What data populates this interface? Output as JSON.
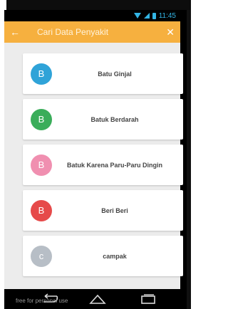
{
  "status": {
    "time": "11:45"
  },
  "appbar": {
    "search_placeholder": "Cari Data Penyakit"
  },
  "items": [
    {
      "initial": "B",
      "label": "Batu Ginjal",
      "color": "#2fa3d8"
    },
    {
      "initial": "B",
      "label": "Batuk Berdarah",
      "color": "#3aad5a"
    },
    {
      "initial": "B",
      "label": "Batuk Karena Paru-Paru Dingin",
      "color": "#f08fb0"
    },
    {
      "initial": "B",
      "label": "Beri Beri",
      "color": "#e64a4a"
    },
    {
      "initial": "c",
      "label": "campak",
      "color": "#b7bec6"
    }
  ],
  "watermark": "free for personal use",
  "colors": {
    "appbar": "#f6b03f",
    "status_text": "#33b5e5",
    "background": "#ececec"
  }
}
